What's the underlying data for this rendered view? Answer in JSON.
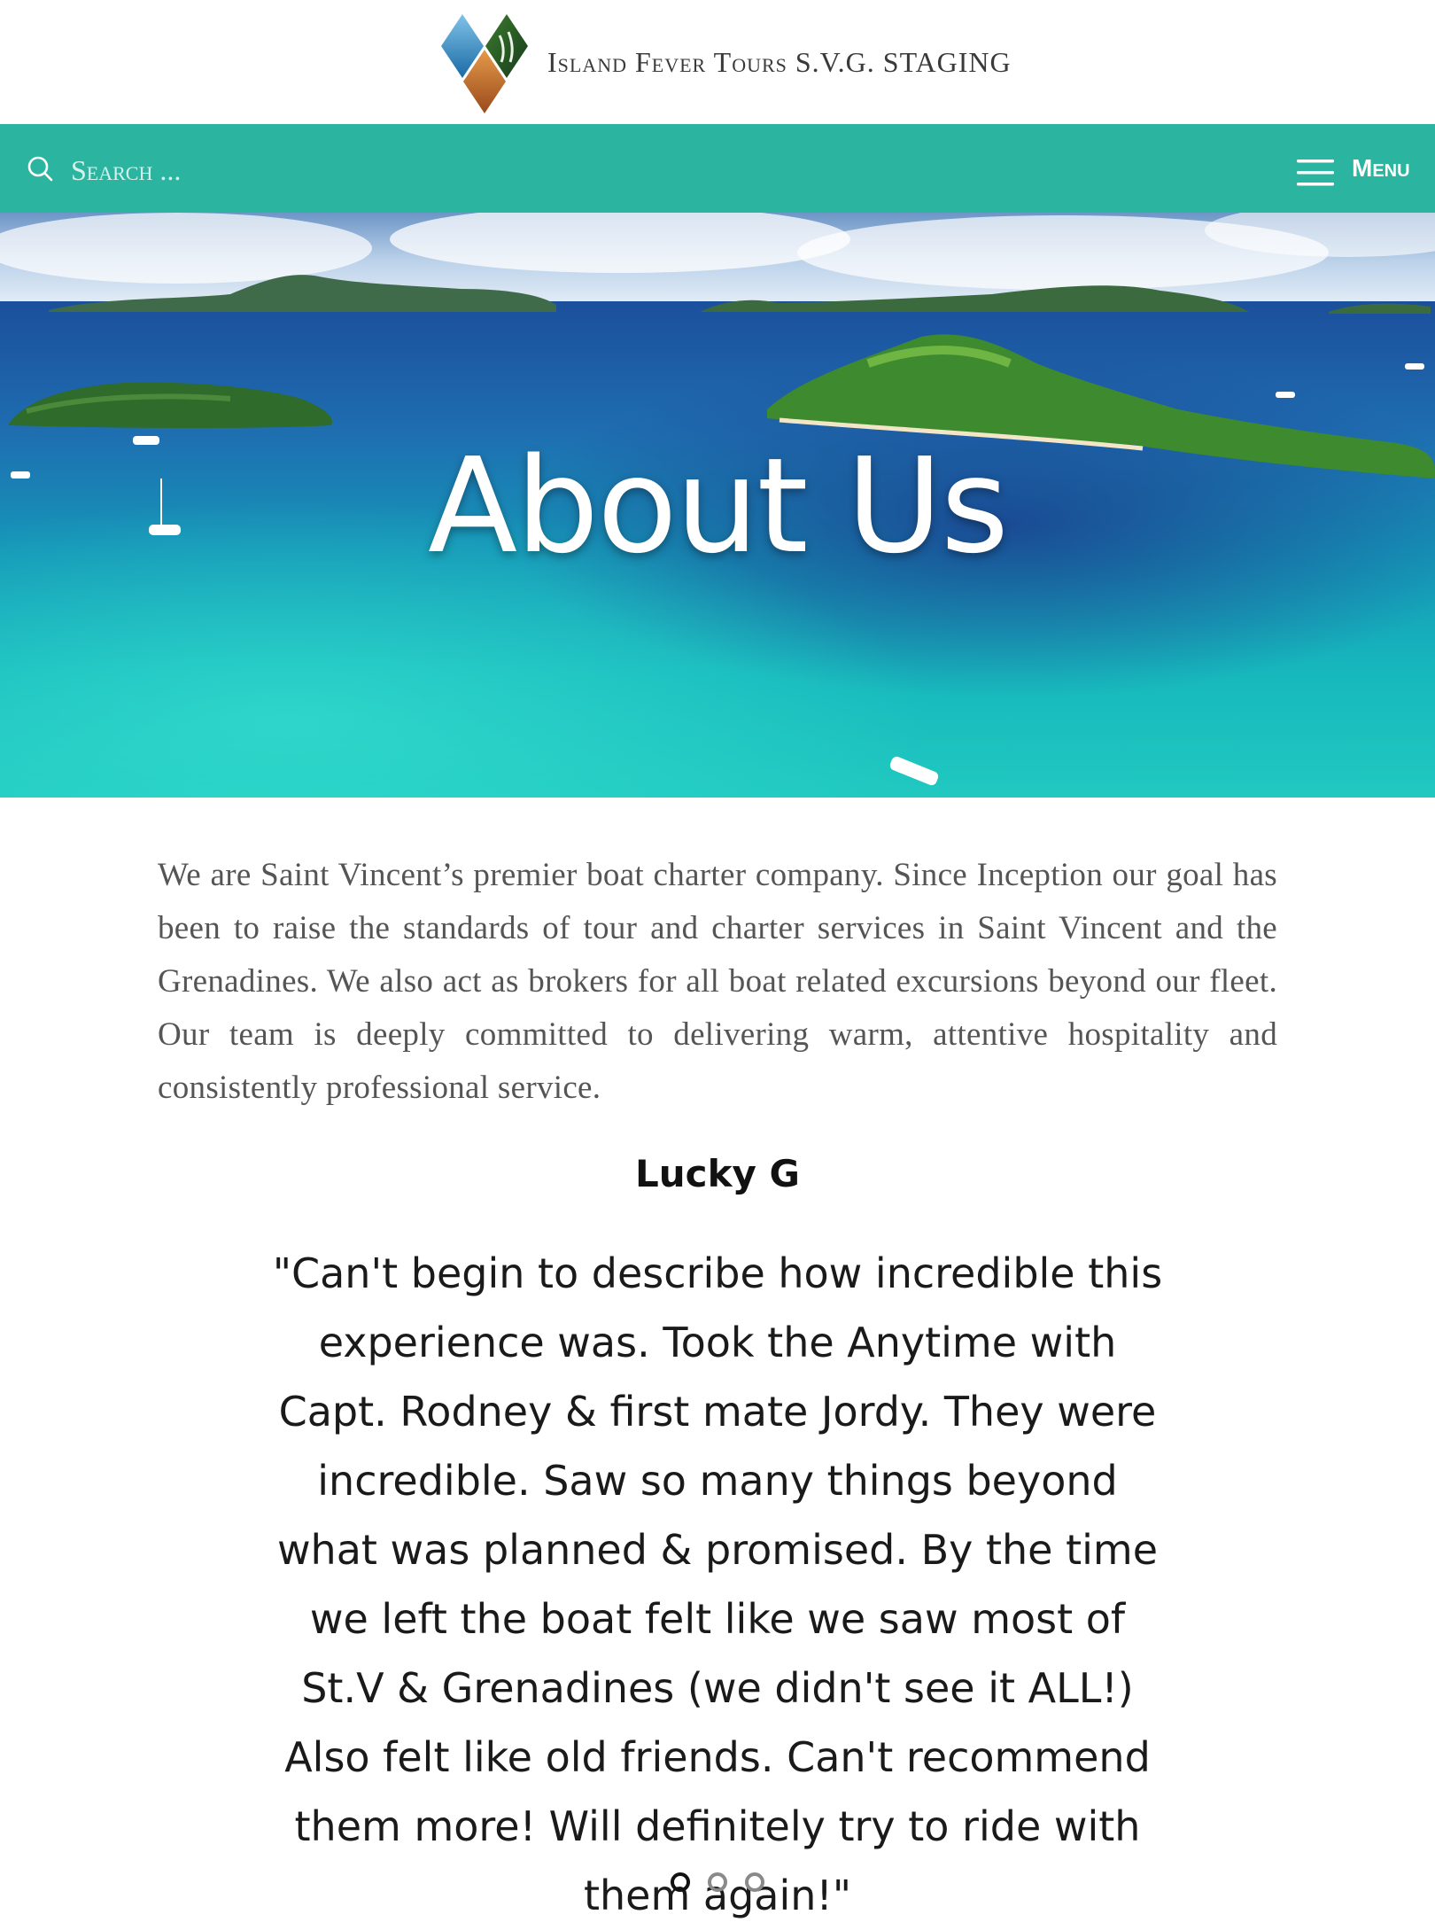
{
  "header": {
    "site_title": "Island Fever Tours S.V.G. STAGING",
    "logo_icon": "diamond-logo-icon"
  },
  "nav": {
    "search_placeholder": "Search ...",
    "search_icon": "search-icon",
    "menu_label": "Menu",
    "menu_icon": "hamburger-icon",
    "bar_color": "#2bb5a0"
  },
  "hero": {
    "title": "About Us",
    "image": "aerial view of turquoise sea with green islands and boats"
  },
  "intro": {
    "text": "We are Saint Vincent’s premier boat charter company. Since Inception our goal has been to raise the standards of tour and charter services in Saint Vincent and the Grenadines.  We also act as brokers for all boat related excursions beyond our fleet. Our team is deeply committed to delivering warm, attentive hospitality and consistently professional service."
  },
  "testimonial": {
    "name": "Lucky G",
    "quote": "\"Can't begin to describe how incredible this experience was. Took the Anytime with Capt. Rodney & first mate Jordy. They were incredible. Saw so many things beyond what was planned & promised. By the time we left the boat felt like we saw most of St.V & Grenadines (we didn't see it ALL!) Also felt like old friends. Can't recommend them more! Will definitely try to ride with them again!\"",
    "slide_count": 3,
    "active_slide": 1
  }
}
